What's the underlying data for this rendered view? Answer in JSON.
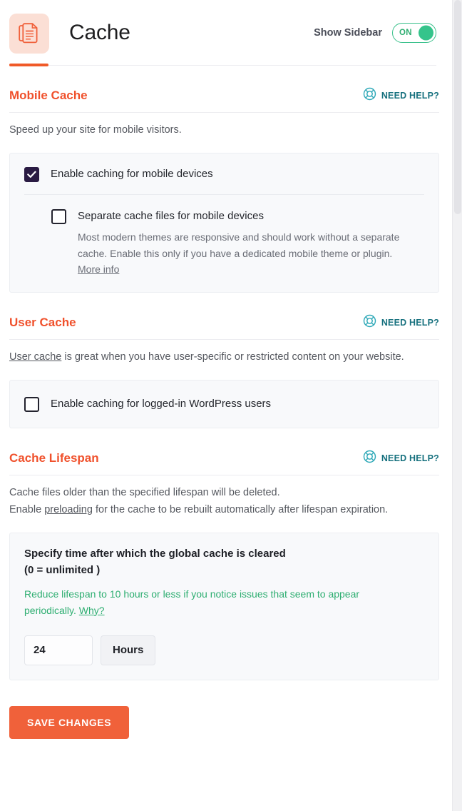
{
  "header": {
    "icon": "documents-icon",
    "title": "Cache",
    "sidebar_label": "Show Sidebar",
    "toggle_state": "ON",
    "accent": "#f0512c",
    "toggle_green": "#2eae71"
  },
  "need_help_label": "NEED HELP?",
  "sections": {
    "mobile_cache": {
      "title": "Mobile Cache",
      "description": "Speed up your site for mobile visitors.",
      "enable_label": "Enable caching for mobile devices",
      "enable_checked": true,
      "separate_label": "Separate cache files for mobile devices",
      "separate_checked": false,
      "separate_desc": "Most modern themes are responsive and should work without a separate cache. Enable this only if you have a dedicated mobile theme or plugin.",
      "more_info_label": "More info"
    },
    "user_cache": {
      "title": "User Cache",
      "desc_link": "User cache",
      "desc_rest": " is great when you have user-specific or restricted content on your website.",
      "enable_label": "Enable caching for logged-in WordPress users",
      "enable_checked": false
    },
    "cache_lifespan": {
      "title": "Cache Lifespan",
      "desc_line1": "Cache files older than the specified lifespan will be deleted.",
      "desc_line2_pre": "Enable ",
      "desc_line2_link": "preloading",
      "desc_line2_post": " for the cache to be rebuilt automatically after lifespan expiration.",
      "specify_line1": "Specify time after which the global cache is cleared",
      "specify_line2": "(0 = unlimited )",
      "note_pre": "Reduce lifespan to 10 hours or less if you notice issues that seem to appear periodically. ",
      "note_link": "Why?",
      "note_color": "#2eae71",
      "value": "24",
      "unit": "Hours"
    }
  },
  "save_button_label": "SAVE CHANGES"
}
